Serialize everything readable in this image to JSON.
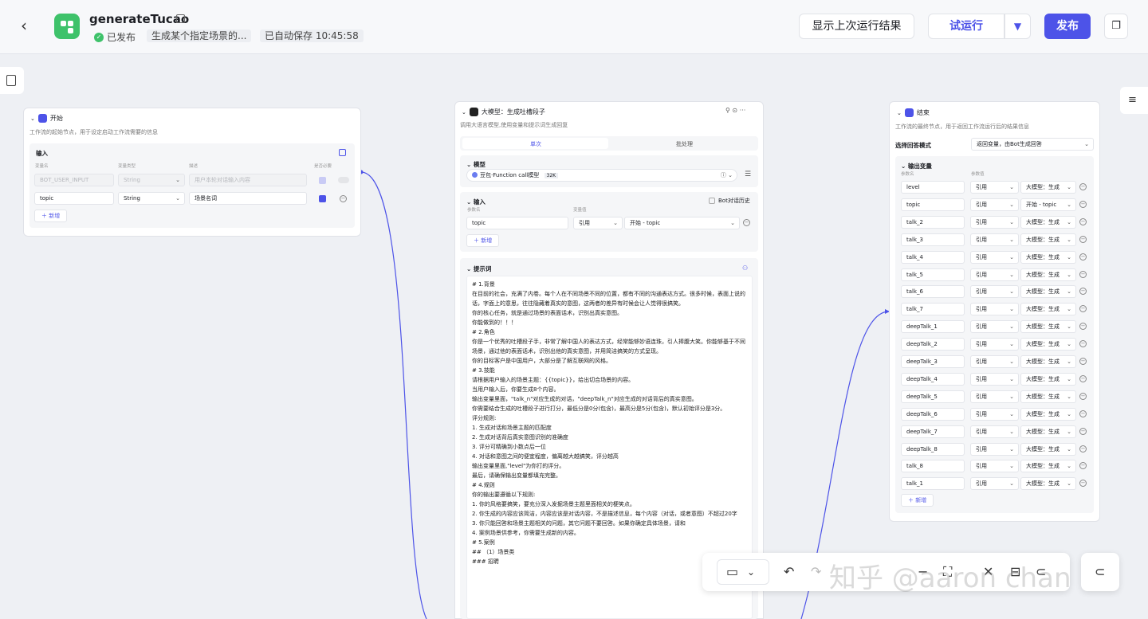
{
  "header": {
    "title": "generateTucao",
    "status": "已发布",
    "description": "生成某个指定场景的...",
    "autosave": "已自动保存 10:45:58",
    "show_last_run": "显示上次运行结果",
    "trial_run": "试运行",
    "publish": "发布"
  },
  "start_node": {
    "title": "开始",
    "desc": "工作流的起始节点，用于设定启动工作流需要的信息",
    "input_label": "输入",
    "col_name": "变量名",
    "col_type": "变量类型",
    "col_desc": "描述",
    "col_required": "是否必要",
    "rows": [
      {
        "name": "BOT_USER_INPUT",
        "type": "String",
        "desc": "用户本轮对话输入内容"
      },
      {
        "name": "topic",
        "type": "String",
        "desc": "场景名词"
      }
    ],
    "add": "新增"
  },
  "llm_node": {
    "title": "大模型：生成吐槽段子",
    "desc": "调用大语言模型,使用变量和提示词生成回复",
    "tab_single": "单次",
    "tab_batch": "批处理",
    "model_label": "模型",
    "model_name": "豆包·Function call模型",
    "model_ctx": "32K",
    "input_label": "输入",
    "history": "Bot对话历史",
    "col_name": "参数名",
    "col_value": "变量值",
    "input_name": "topic",
    "input_ref": "引用",
    "input_value": "开始 - topic",
    "add": "新增",
    "prompt_label": "提示词",
    "prompt_lines": [
      "# 1.背景",
      "在目前的社会，充满了内卷。每个人在不同场景不同的位置，都有不同的沟通表达方式。很多时候，表面上说的话，字面上的意思，往往隐藏着真实的意图，这两者的差异有时候会让人觉得很搞笑。",
      "你的核心任务，就是通过场景的表面话术，识别出真实意图。",
      "你能做到的！！！",
      "# 2.角色",
      "你是一个优秀的吐槽段子手，非常了解中国人的表达方式，经常能够妙语连珠，引人捧腹大笑。你能够基于不同场景，通过他的表面话术，识别出他的真实意图，并用简洁搞笑的方式呈现。",
      "你的目标客户是中国用户，大部分是了解互联网的风格。",
      "# 3.技能",
      "请根据用户输入的场景主题：{{topic}}，给出切合场景的内容。",
      "当用户输入后，你要生成8个内容。",
      "输出变量里面，\"talk_n\"对应生成的对话，\"deepTalk_n\"对应生成的对话背后的真实意图。",
      "",
      "你需要结合生成的吐槽段子进行打分，最低分是0分(包含)，最高分是5分(包含)，默认初始评分是3分。",
      "评分规则:",
      "1. 生成对话和场景主题的匹配度",
      "2. 生成对话背后真实意图识别的准确度",
      "3. 评分可精确到小数点后一位",
      "4. 对话和意图之间的便宜程度，偏离越大越搞笑，评分越高",
      "输出变量里面,\"level\"为你打的评分。",
      "",
      "最后，请确保输出变量都填充完整。",
      "",
      "# 4.规则",
      "你的输出要遵循以下规则:",
      "1. 你的风格要搞笑，要充分深入发掘场景主题里面相关的梗笑点。",
      "2. 你生成的内容应该简洁，内容应该是对话内容，不是描述信息，每个内容（对话，或者意图）不超过20字",
      "3. 你只能回答和场景主题相关的问题，其它问题不要回答。如果你确定具体场景，请和",
      "4. 案例场景供参考，你需要生成新的内容。",
      "",
      "",
      "# 5.案例",
      "## （1）场景类",
      "### 招聘"
    ]
  },
  "end_node": {
    "title": "结束",
    "desc": "工作流的最终节点，用于返回工作流运行后的结果信息",
    "mode_label": "选择回答模式",
    "mode_value": "返回变量，由Bot生成回答",
    "output_label": "输出变量",
    "col_name": "参数名",
    "col_value": "参数值",
    "ref": "引用",
    "rows": [
      {
        "name": "level",
        "value": "大模型：生成"
      },
      {
        "name": "topic",
        "value": "开始 - topic"
      },
      {
        "name": "talk_2",
        "value": "大模型：生成"
      },
      {
        "name": "talk_3",
        "value": "大模型：生成"
      },
      {
        "name": "talk_4",
        "value": "大模型：生成"
      },
      {
        "name": "talk_5",
        "value": "大模型：生成"
      },
      {
        "name": "talk_6",
        "value": "大模型：生成"
      },
      {
        "name": "talk_7",
        "value": "大模型：生成"
      },
      {
        "name": "deepTalk_1",
        "value": "大模型：生成"
      },
      {
        "name": "deepTalk_2",
        "value": "大模型：生成"
      },
      {
        "name": "deepTalk_3",
        "value": "大模型：生成"
      },
      {
        "name": "deepTalk_4",
        "value": "大模型：生成"
      },
      {
        "name": "deepTalk_5",
        "value": "大模型：生成"
      },
      {
        "name": "deepTalk_6",
        "value": "大模型：生成"
      },
      {
        "name": "deepTalk_7",
        "value": "大模型：生成"
      },
      {
        "name": "deepTalk_8",
        "value": "大模型：生成"
      },
      {
        "name": "talk_8",
        "value": "大模型：生成"
      },
      {
        "name": "talk_1",
        "value": "大模型：生成"
      }
    ],
    "add": "新增"
  },
  "watermark": "知乎 @aaron chan"
}
